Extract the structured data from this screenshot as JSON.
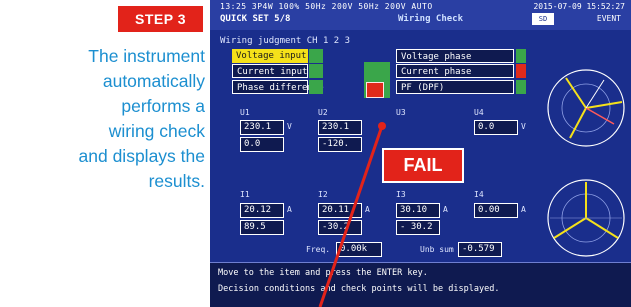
{
  "step": {
    "label": "STEP 3"
  },
  "description": {
    "lines": [
      "The instrument",
      "automatically",
      "performs a",
      "wiring check",
      "and displays the",
      "results."
    ]
  },
  "screen": {
    "status_line": "13:25  3P4W  100%  50Hz 200V  50Hz  200V  AUTO",
    "date": "2015-07-09 15:52:27",
    "header_left": "QUICK SET 5/8",
    "header_title": "Wiring Check",
    "header_event": "EVENT",
    "sd_label": "SD",
    "judgment_title": "Wiring judgment  CH 1 2 3",
    "checks": {
      "voltage_input": "Voltage input",
      "current_input": "Current input",
      "phase_difference": "Phase difference",
      "voltage_phase": "Voltage phase",
      "current_phase": "Current phase",
      "pf": "PF (DPF)"
    },
    "u_labels": [
      "U1",
      "U2",
      "U3",
      "U4"
    ],
    "u_values": [
      "230.1",
      "230.1",
      "",
      "0.0"
    ],
    "u_angles": [
      "0.0",
      "-120.",
      "",
      ""
    ],
    "u_unit": "V",
    "i_labels": [
      "I1",
      "I2",
      "I3",
      "I4"
    ],
    "i_values": [
      "20.12",
      "20.11",
      "30.10",
      "0.00"
    ],
    "i_angles": [
      "89.5",
      "-30.2",
      "- 30.2",
      ""
    ],
    "i_unit": "A",
    "freq_label": "Freq.",
    "freq_value": "0.00k",
    "unb_label": "Unb sum",
    "unb_value": "-0.579",
    "footer_line1": "Move to the item and press the ENTER key.",
    "footer_line2": "Decision conditions and check points will be displayed."
  },
  "fail_label": "FAIL"
}
